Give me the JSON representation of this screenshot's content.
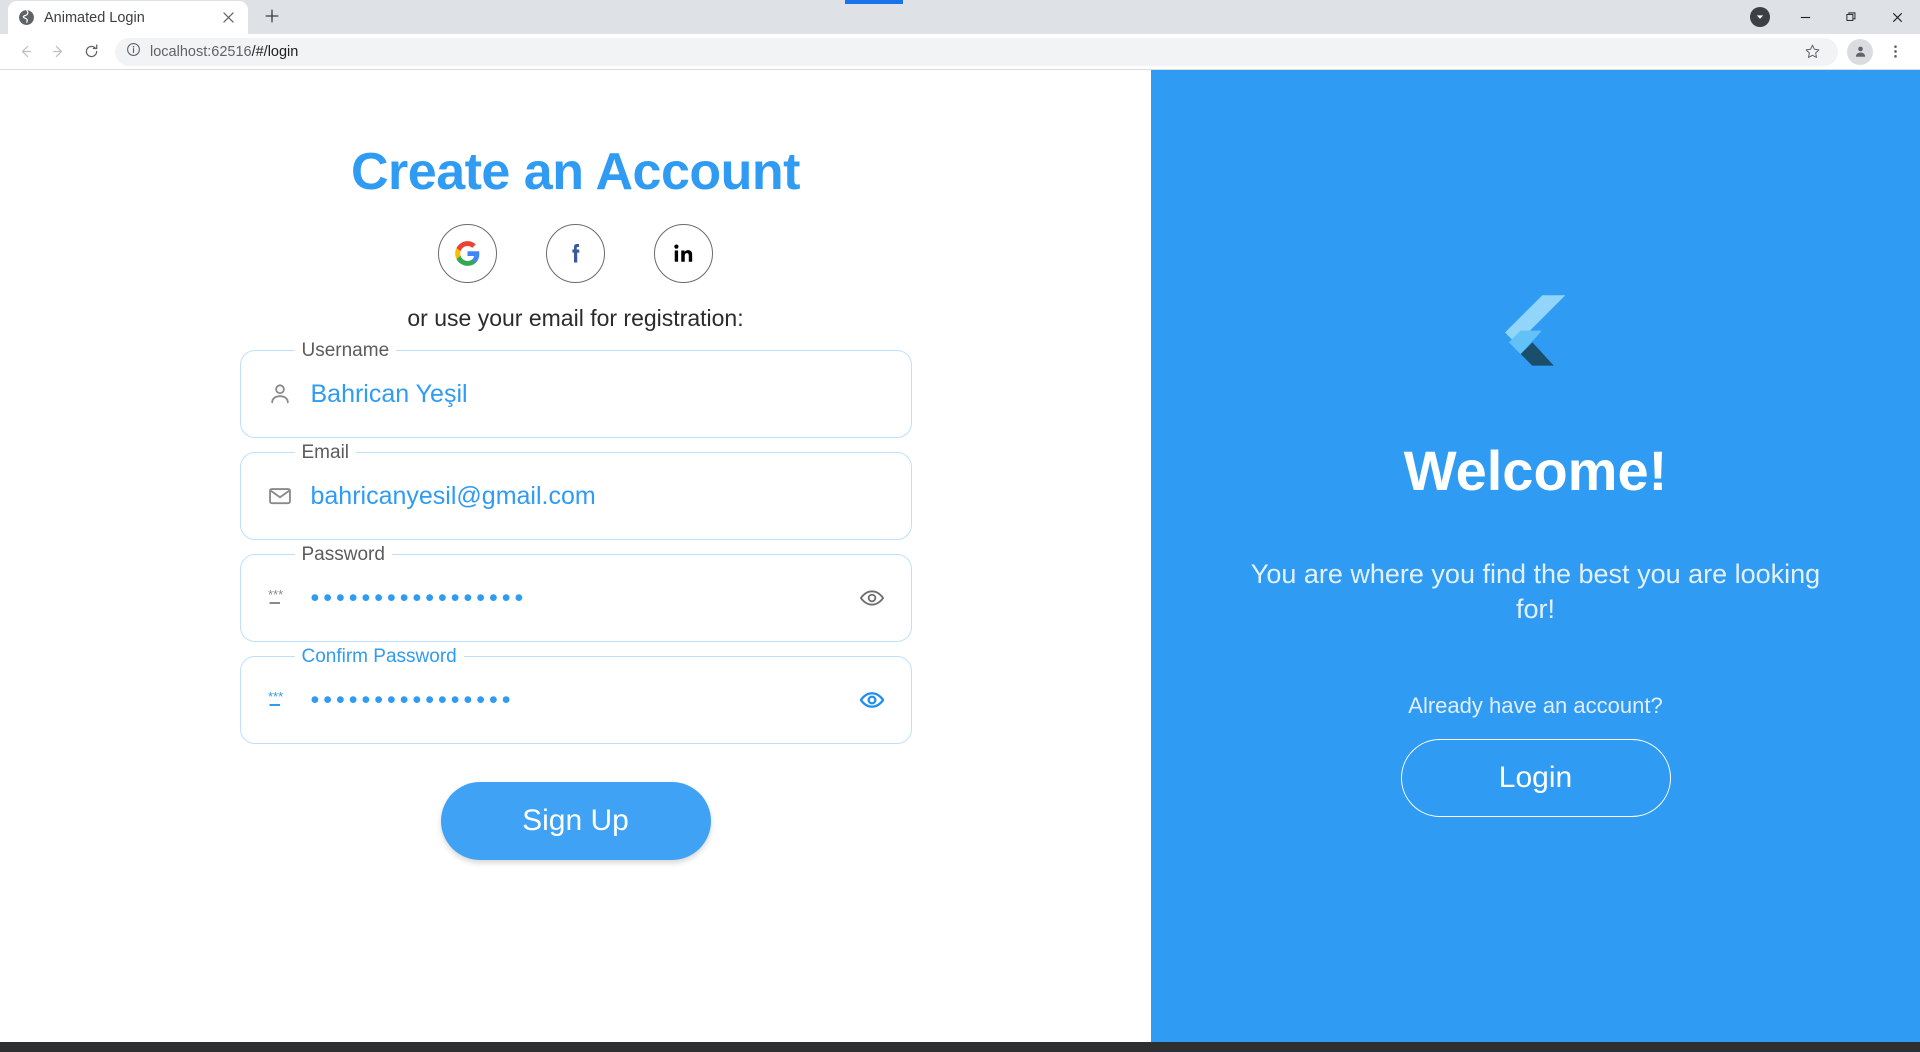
{
  "browser": {
    "tab": {
      "title": "Animated Login",
      "favicon_icon": "globe-icon",
      "close_icon": "close-icon"
    },
    "new_tab_label": "+",
    "window_controls": {
      "download_icon": "download-chevron-icon",
      "minimize_label": "—",
      "maximize_icon": "restore-icon",
      "close_label": "✕"
    },
    "toolbar": {
      "back_icon": "arrow-left-icon",
      "forward_icon": "arrow-right-icon",
      "reload_icon": "reload-icon",
      "info_icon": "info-circle-icon",
      "url_host": "localhost:62516",
      "url_path": "/#/login",
      "bookmark_icon": "star-icon",
      "profile_icon": "person-avatar-icon",
      "menu_icon": "three-dot-menu-icon"
    }
  },
  "signup": {
    "title": "Create an Account",
    "socials": [
      {
        "name": "google-signin-button",
        "icon": "google-icon"
      },
      {
        "name": "facebook-signin-button",
        "icon": "facebook-icon"
      },
      {
        "name": "linkedin-signin-button",
        "icon": "linkedin-icon"
      }
    ],
    "subtitle": "or use your email for registration:",
    "fields": [
      {
        "key": "username",
        "label": "Username",
        "value": "Bahrican Yeşil",
        "icon": "person-icon",
        "focused": false,
        "obscured": false
      },
      {
        "key": "email",
        "label": "Email",
        "value": "bahricanyesil@gmail.com",
        "icon": "envelope-icon",
        "focused": false,
        "obscured": false
      },
      {
        "key": "password",
        "label": "Password",
        "value": "•••••••••••••••••",
        "icon": "password-asterisk-icon",
        "focused": false,
        "obscured": true,
        "toggle_icon": "eye-icon"
      },
      {
        "key": "confirm_password",
        "label": "Confirm Password",
        "value": "••••••••••••••••",
        "icon": "password-asterisk-icon",
        "focused": true,
        "obscured": true,
        "toggle_icon": "eye-icon"
      }
    ],
    "submit_label": "Sign Up"
  },
  "welcome": {
    "logo_icon": "flutter-logo-icon",
    "title": "Welcome!",
    "text": "You are where you find the best you are looking for!",
    "account_note": "Already have an account?",
    "login_label": "Login"
  },
  "colors": {
    "brand_blue": "#2f9bf3",
    "panel_blue": "#2f9bf3",
    "field_border": "#bfdffc",
    "button_blue": "#3fa2f4"
  }
}
